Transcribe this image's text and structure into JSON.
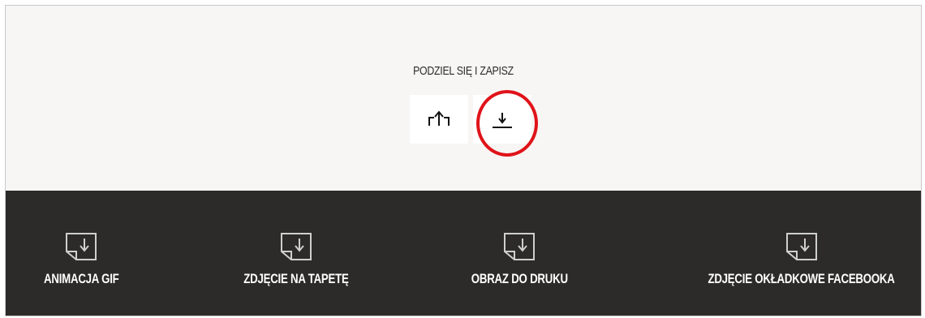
{
  "share_section": {
    "title": "PODZIEL SIĘ I ZAPISZ",
    "buttons": [
      {
        "icon": "share-icon"
      },
      {
        "icon": "download-icon"
      }
    ],
    "highlight_color": "#e0131a"
  },
  "downloads": {
    "items": [
      {
        "label": "ANIMACJA GIF",
        "icon": "file-download-icon"
      },
      {
        "label": "ZDJĘCIE NA TAPETĘ",
        "icon": "file-download-icon"
      },
      {
        "label": "OBRAZ DO DRUKU",
        "icon": "file-download-icon"
      },
      {
        "label": "ZDJĘCIE OKŁADKOWE FACEBOOKA",
        "icon": "file-download-icon"
      }
    ]
  },
  "colors": {
    "top_background": "#f7f6f4",
    "bottom_background": "#2c2b29",
    "text_light": "#ffffff"
  }
}
